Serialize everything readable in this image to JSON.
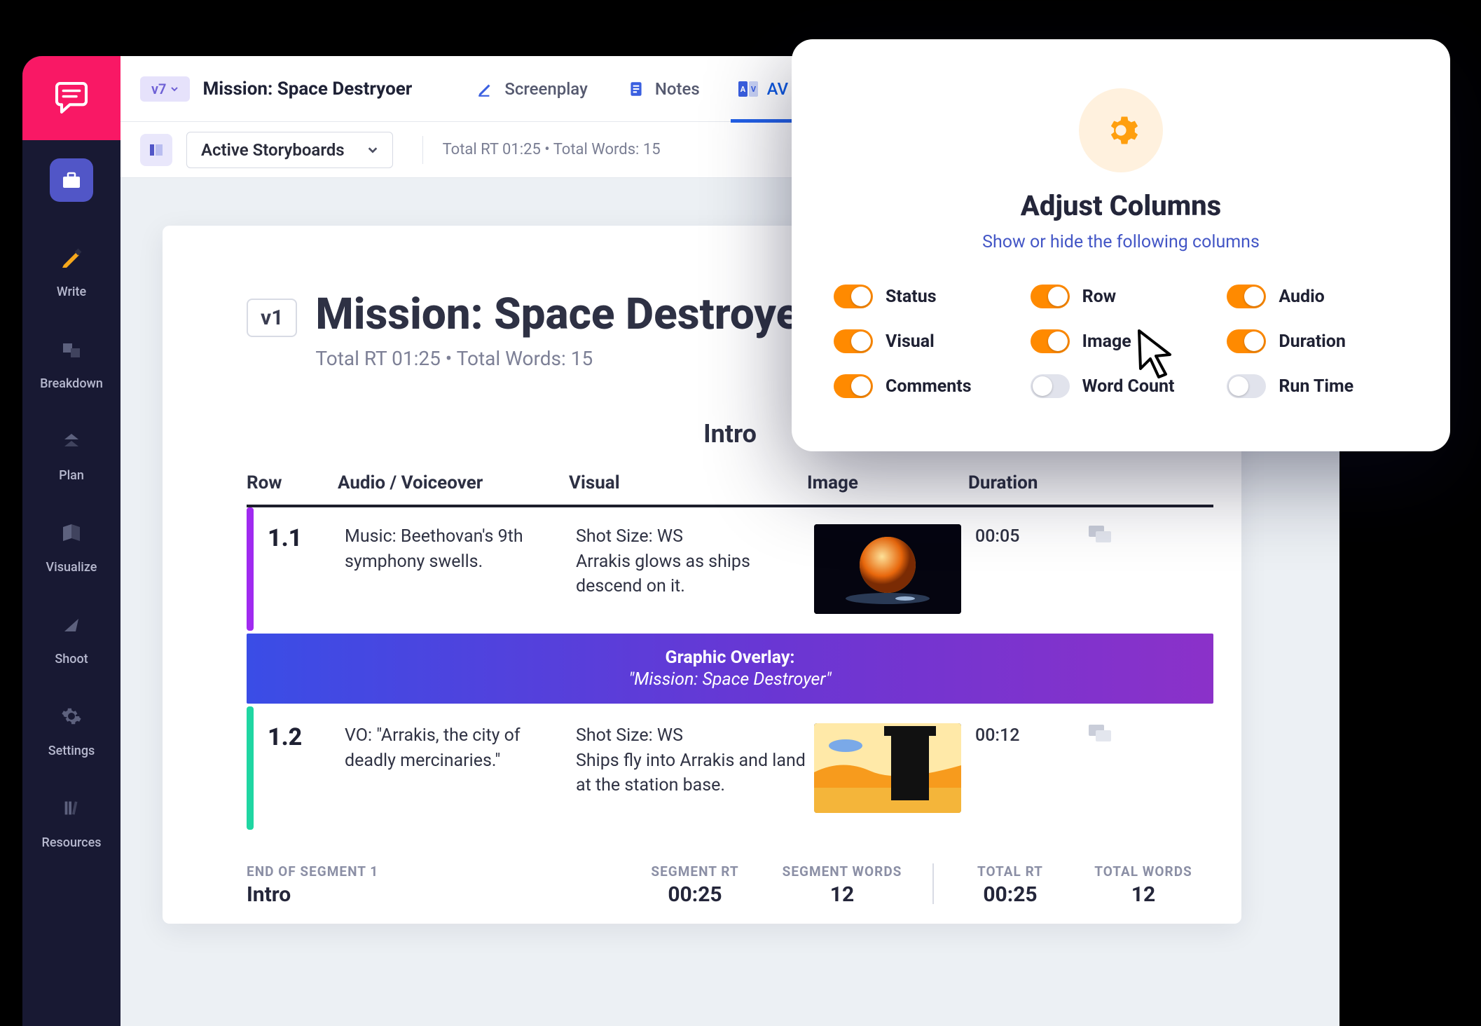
{
  "topbar": {
    "version_chip": "v7",
    "project_title": "Mission: Space Destryoer",
    "tabs": {
      "screenplay": "Screenplay",
      "notes": "Notes",
      "av_scripts": "AV Scripts"
    }
  },
  "subbar": {
    "storyboard_select_label": "Active Storyboards",
    "meta": "Total RT 01:25 • Total Words: 15"
  },
  "sidebar": {
    "items": [
      {
        "label": ""
      },
      {
        "label": "Write"
      },
      {
        "label": "Breakdown"
      },
      {
        "label": "Plan"
      },
      {
        "label": "Visualize"
      },
      {
        "label": "Shoot"
      },
      {
        "label": "Settings"
      },
      {
        "label": "Resources"
      }
    ]
  },
  "sheet": {
    "version_badge": "v1",
    "title": "Mission: Space Destroyer",
    "subtitle": "Total RT 01:25 • Total Words: 15",
    "segment_name": "Intro",
    "columns": {
      "row": "Row",
      "audio": "Audio / Voiceover",
      "visual": "Visual",
      "image": "Image",
      "duration": "Duration"
    },
    "rows": [
      {
        "accent": "#a02af0",
        "row": "1.1",
        "audio": "Music: Beethovan's 9th symphony swells.",
        "visual": "Shot Size: WS\nArrakis glows as ships descend on it.",
        "duration": "00:05"
      },
      {
        "accent": "#1fd6a2",
        "row": "1.2",
        "audio": "VO: \"Arrakis, the city of deadly mercinaries.\"",
        "visual": "Shot Size: WS\nShips fly into Arrakis and land at the station base.",
        "duration": "00:12"
      }
    ],
    "overlay": {
      "title": "Graphic Overlay:",
      "subtitle": "\"Mission: Space Destroyer\""
    },
    "footer": {
      "end_label": "END OF SEGMENT 1",
      "end_value": "Intro",
      "seg_rt_label": "SEGMENT RT",
      "seg_rt_value": "00:25",
      "seg_words_label": "SEGMENT WORDS",
      "seg_words_value": "12",
      "total_rt_label": "TOTAL RT",
      "total_rt_value": "00:25",
      "total_words_label": "TOTAL WORDS",
      "total_words_value": "12"
    }
  },
  "popover": {
    "title": "Adjust Columns",
    "hint": "Show or hide the following columns",
    "toggles": [
      {
        "label": "Status",
        "on": true
      },
      {
        "label": "Row",
        "on": true
      },
      {
        "label": "Audio",
        "on": true
      },
      {
        "label": "Visual",
        "on": true
      },
      {
        "label": "Image",
        "on": true
      },
      {
        "label": "Duration",
        "on": true
      },
      {
        "label": "Comments",
        "on": true
      },
      {
        "label": "Word Count",
        "on": false
      },
      {
        "label": "Run Time",
        "on": false
      }
    ]
  }
}
